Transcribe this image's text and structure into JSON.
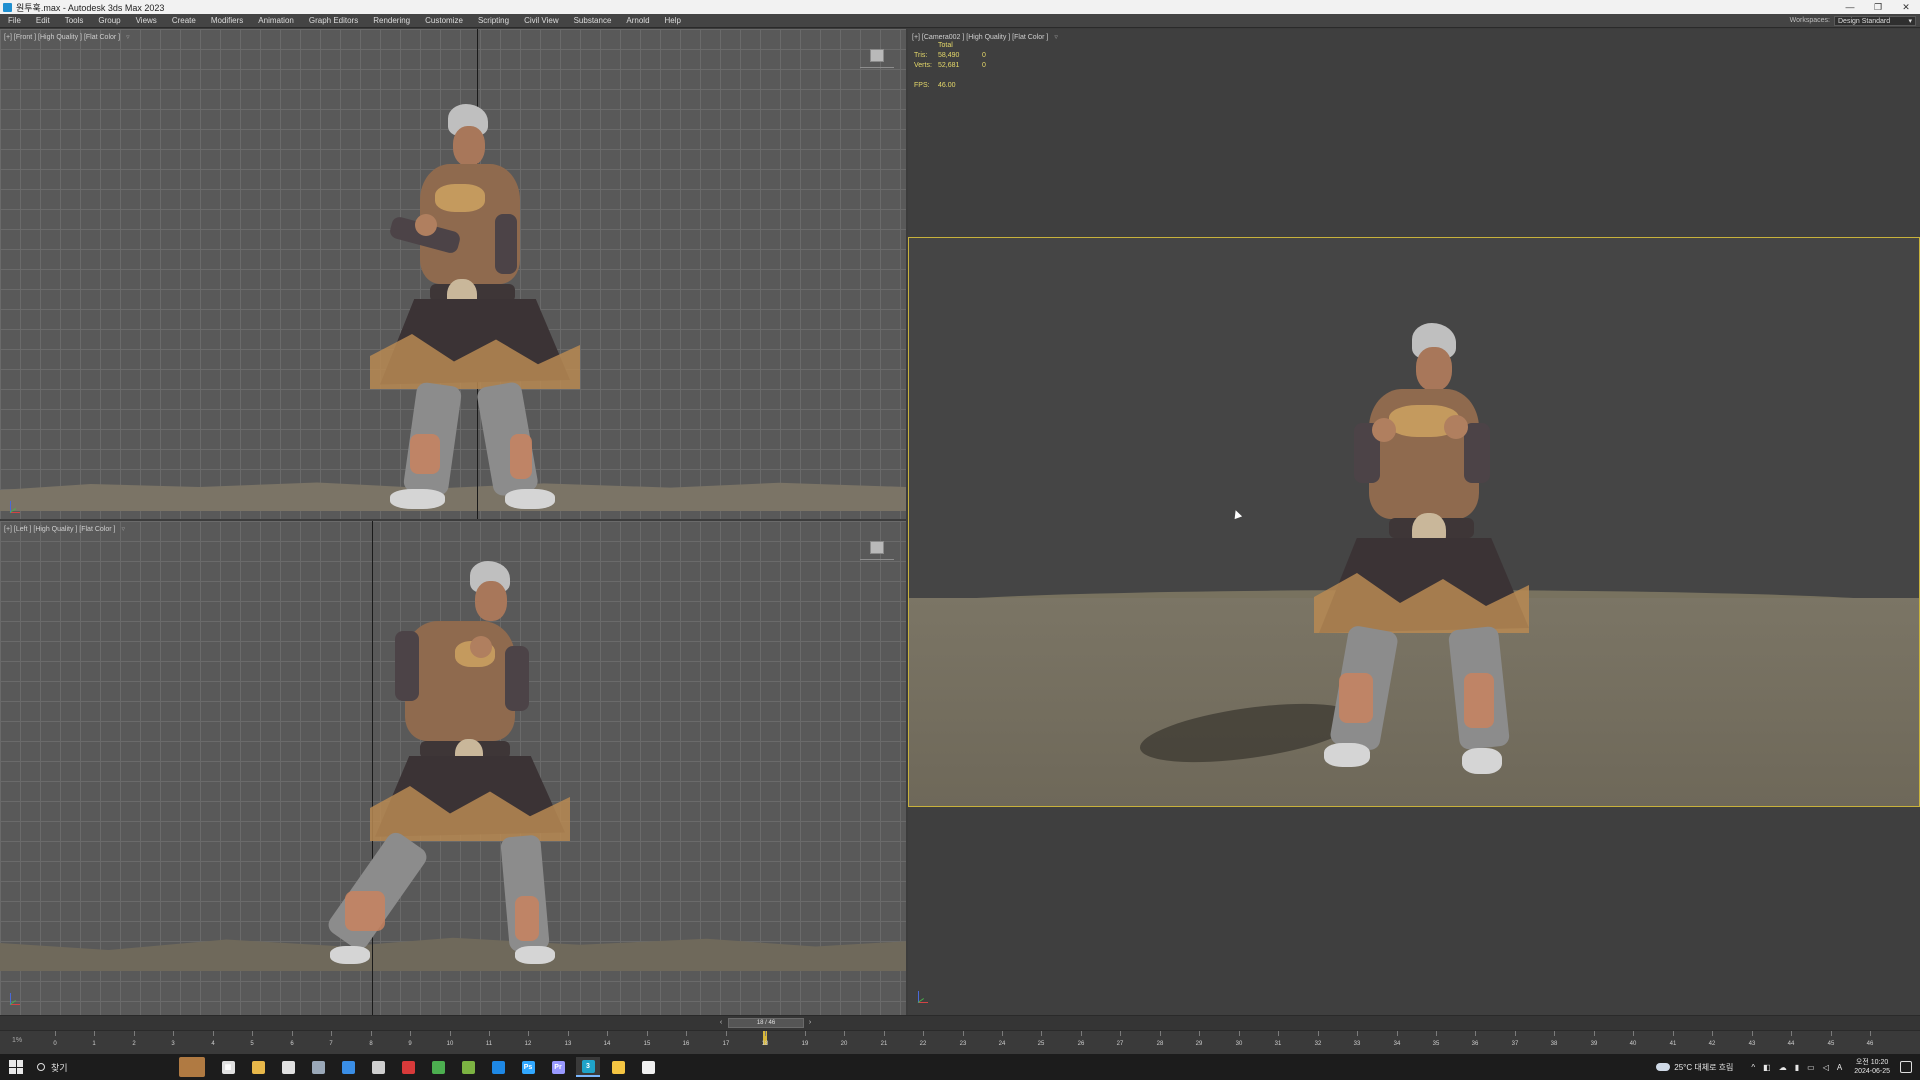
{
  "window": {
    "title": "원투훅.max - Autodesk 3ds Max 2023",
    "minimize_glyph": "—",
    "restore_glyph": "❐",
    "close_glyph": "✕"
  },
  "menu": {
    "items": [
      "File",
      "Edit",
      "Tools",
      "Group",
      "Views",
      "Create",
      "Modifiers",
      "Animation",
      "Graph Editors",
      "Rendering",
      "Customize",
      "Scripting",
      "Civil View",
      "Substance",
      "Arnold",
      "Help"
    ],
    "workspace_label": "Workspaces:",
    "workspace_value": "Design Standard"
  },
  "viewports": {
    "front": {
      "label": "[+] [Front ] [High Quality ] [Flat Color ]",
      "filter_icon": "filter-icon"
    },
    "left": {
      "label": "[+] [Left ] [High Quality ] [Flat Color ]",
      "filter_icon": "filter-icon"
    },
    "camera": {
      "label": "[+] [Camera002 ] [High Quality ] [Flat Color ]",
      "stats": {
        "header": "Total",
        "tris_label": "Tris:",
        "tris_value": "58,490",
        "tris_sel": "0",
        "verts_label": "Verts:",
        "verts_value": "52,681",
        "verts_sel": "0",
        "fps_label": "FPS:",
        "fps_value": "46.00"
      }
    }
  },
  "timeline": {
    "slider_text": "18 / 46",
    "current_frame": 18,
    "total_frames": 46,
    "corner_label": "1%",
    "ticks": [
      "0",
      "1",
      "2",
      "3",
      "4",
      "5",
      "6",
      "7",
      "8",
      "9",
      "10",
      "11",
      "12",
      "13",
      "14",
      "15",
      "16",
      "17",
      "18",
      "19",
      "20",
      "21",
      "22",
      "23",
      "24",
      "25",
      "26",
      "27",
      "28",
      "29",
      "30",
      "31",
      "32",
      "33",
      "34",
      "35",
      "36",
      "37",
      "38",
      "39",
      "40",
      "41",
      "42",
      "43",
      "44",
      "45",
      "46"
    ]
  },
  "taskbar": {
    "search_label": "찾기",
    "apps": [
      {
        "name": "task-view-icon",
        "glyph": "▦",
        "color": "#e0e0e0"
      },
      {
        "name": "file-explorer-icon",
        "glyph": "",
        "color": "#e8b84a"
      },
      {
        "name": "calendar-icon",
        "glyph": "",
        "color": "#e0e0e0"
      },
      {
        "name": "steam-icon",
        "glyph": "",
        "color": "#9aa8b8"
      },
      {
        "name": "mail-icon",
        "glyph": "",
        "color": "#3a8ee6"
      },
      {
        "name": "terminal-icon",
        "glyph": "",
        "color": "#cfcfcf"
      },
      {
        "name": "record-icon",
        "glyph": "",
        "color": "#d83a3a"
      },
      {
        "name": "chrome-icon",
        "glyph": "",
        "color": "#4caf50"
      },
      {
        "name": "nvidia-icon",
        "glyph": "",
        "color": "#7cb342"
      },
      {
        "name": "edge-icon",
        "glyph": "",
        "color": "#1e88e5"
      },
      {
        "name": "photoshop-icon",
        "glyph": "Ps",
        "color": "#31a8ff"
      },
      {
        "name": "premiere-icon",
        "glyph": "Pr",
        "color": "#9999ff"
      },
      {
        "name": "3dsmax-icon",
        "glyph": "3",
        "color": "#1fa3c9"
      },
      {
        "name": "sticky-notes-icon",
        "glyph": "",
        "color": "#f5c542"
      },
      {
        "name": "notepad-icon",
        "glyph": "",
        "color": "#f0f0f0"
      }
    ],
    "weather": "25°C  대체로 흐림",
    "tray_glyphs": [
      "^",
      "◧",
      "☁",
      "▮",
      "▭",
      "◁",
      "A"
    ],
    "time": "오전 10:20",
    "date": "2024-06-25"
  },
  "colors": {
    "accent": "#c8b23c",
    "stats": "#e6d96a",
    "viewport_bg": "#595959"
  }
}
